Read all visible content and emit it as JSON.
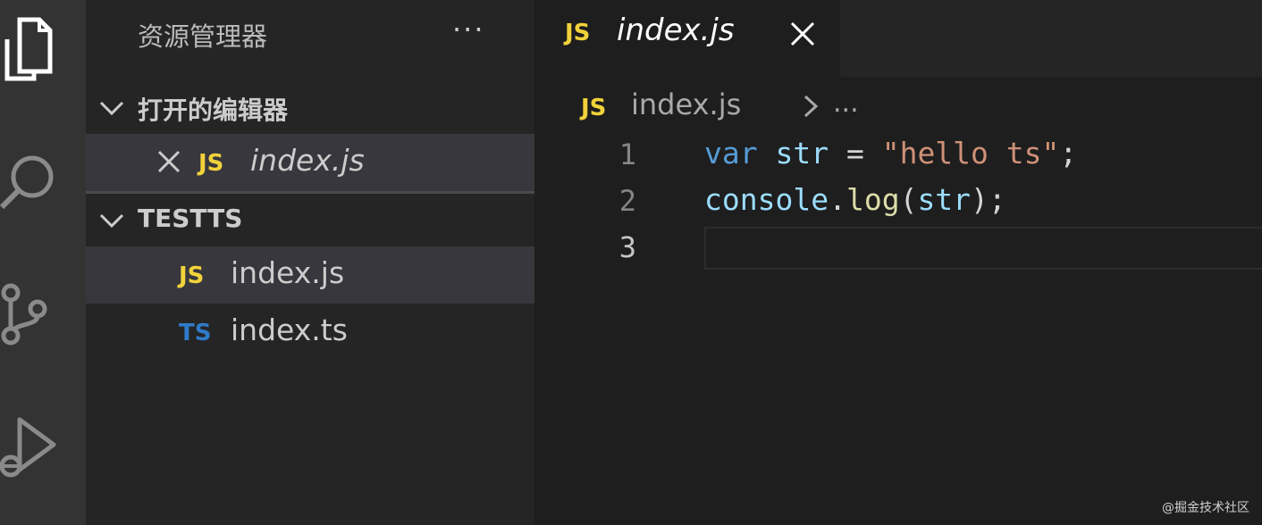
{
  "sidebar": {
    "title": "资源管理器",
    "more": "···",
    "open_editors": {
      "label": "打开的编辑器",
      "items": [
        {
          "badge": "JS",
          "name": "index.js"
        }
      ]
    },
    "folder": {
      "label": "TESTTS",
      "items": [
        {
          "badge": "JS",
          "name": "index.js"
        },
        {
          "badge": "TS",
          "name": "index.ts"
        }
      ]
    }
  },
  "editor": {
    "tab": {
      "badge": "JS",
      "title": "index.js"
    },
    "breadcrumb": {
      "badge": "JS",
      "file": "index.js",
      "more": "..."
    },
    "line_numbers": [
      "1",
      "2",
      "3"
    ],
    "code": {
      "line1": {
        "kw": "var",
        "v1": "str",
        "eq": " = ",
        "s": "\"hello ts\"",
        "end": ";"
      },
      "line2": {
        "obj": "console",
        "dot": ".",
        "fn": "log",
        "p1": "(",
        "arg": "str",
        "p2": ");"
      }
    }
  },
  "watermark": "@掘金技术社区",
  "colors": {
    "js_badge": "#f1d23b",
    "ts_badge": "#2f7ac7",
    "keyword": "#569cd6",
    "variable": "#9cdcfe",
    "string": "#ce9178",
    "function": "#dcdcaa"
  },
  "icons": [
    "files-icon",
    "search-icon",
    "source-control-icon",
    "run-debug-icon",
    "chevron-down-icon",
    "close-icon",
    "chevron-right-icon"
  ]
}
